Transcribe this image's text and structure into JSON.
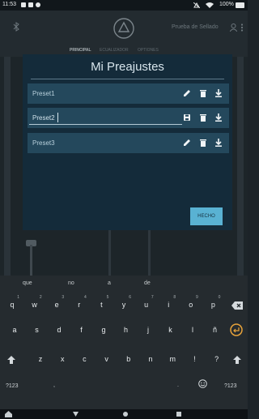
{
  "status_bar": {
    "time": "11:53",
    "battery": "100%",
    "icons": [
      "notification-icon",
      "notification-icon",
      "notification-icon",
      "mute-icon",
      "wifi-icon",
      "battery-icon"
    ]
  },
  "app_bar": {
    "title": "Prueba de Sellado",
    "icons": [
      "bluetooth-icon",
      "logo-icon",
      "profile-icon",
      "more-icon"
    ]
  },
  "tabs": [
    {
      "label": "PRINCIPAL",
      "active": true
    },
    {
      "label": "ECUALIZADOR",
      "active": false
    },
    {
      "label": "OPTIONES",
      "active": false
    }
  ],
  "dialog": {
    "title": "Mi Preajustes",
    "presets": [
      {
        "label": "Preset1",
        "editing": false,
        "icons": [
          "pencil-icon",
          "trash-icon",
          "download-icon"
        ]
      },
      {
        "label": "Preset2",
        "editing": true,
        "icons": [
          "save-icon",
          "trash-icon",
          "download-icon"
        ]
      },
      {
        "label": "Preset3",
        "editing": false,
        "icons": [
          "pencil-icon",
          "trash-icon",
          "download-icon"
        ]
      }
    ],
    "done_label": "HECHO"
  },
  "keyboard": {
    "suggestions": [
      "que",
      "no",
      "a",
      "de"
    ],
    "row1": [
      {
        "k": "q",
        "h": "1"
      },
      {
        "k": "w",
        "h": "2"
      },
      {
        "k": "e",
        "h": "3"
      },
      {
        "k": "r",
        "h": "4"
      },
      {
        "k": "t",
        "h": "5"
      },
      {
        "k": "y",
        "h": "6"
      },
      {
        "k": "u",
        "h": "7"
      },
      {
        "k": "i",
        "h": "8"
      },
      {
        "k": "o",
        "h": "9"
      },
      {
        "k": "p",
        "h": "0"
      }
    ],
    "row2": [
      "a",
      "s",
      "d",
      "f",
      "g",
      "h",
      "j",
      "k",
      "l",
      "ñ"
    ],
    "row3": [
      "z",
      "x",
      "c",
      "v",
      "b",
      "n",
      "m",
      "!",
      "?"
    ],
    "row4": {
      "symbols": "?123",
      "comma": ",",
      "period": ".",
      "symbols_right": "?123"
    },
    "accent_color": "#e8a33a"
  },
  "nav_bar": {
    "icons": [
      "keyboard-switch-icon",
      "back-icon",
      "home-icon",
      "recents-icon"
    ]
  }
}
